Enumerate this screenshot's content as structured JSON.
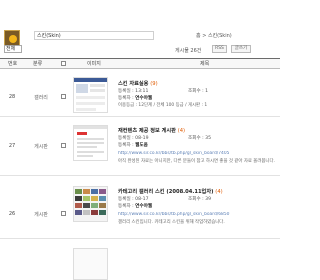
{
  "header": {
    "search_value": "스킨(Skin)",
    "breadcrumb": "홈 > 스킨(Skin)"
  },
  "toolbar": {
    "select_label": "전체",
    "count_text": "게시물 26건",
    "rss_label": "RSS",
    "write_label": "글쓰기"
  },
  "table": {
    "columns": [
      "번호",
      "분류",
      "",
      "이미지",
      "제목"
    ],
    "rows": [
      {
        "number": "28",
        "category": "갤러리",
        "title": "스킨 자료실용",
        "comments": "(9)",
        "reg_label": "등록일 :",
        "reg_value": "13:11",
        "views_label": "조회수 :",
        "views_value": "1",
        "author_label": "등록자 :",
        "author_value": "연수야웹",
        "summary1": "이용등급 : 12단계 / 전체 100 등급 / 게시판 : 1",
        "summary2": ""
      },
      {
        "number": "27",
        "category": "게시판",
        "title": "재컨텐츠 제공 정보 게시판",
        "comments": "(4)",
        "reg_label": "등록일 :",
        "reg_value": "08-19",
        "views_label": "조회수 :",
        "views_value": "35",
        "author_label": "등록자 :",
        "author_value": "웹도움",
        "summary1": "http://www.sir.co.kr/bbs/tb.php/gl_skin_board/7405",
        "summary2": "아직 완성된 자료는 아니지만, 다른 분들이 참고 하시면 좋을 것 같아 자료 올려봅니다."
      },
      {
        "number": "26",
        "category": "게시판",
        "title": "카테고리 갤러리 스킨 (2008.04.11업자)",
        "comments": "(4)",
        "reg_label": "등록일 :",
        "reg_value": "08-17",
        "views_label": "조회수 :",
        "views_value": "39",
        "author_label": "등록자 :",
        "author_value": "연수야웹",
        "summary1": "http://www.sir.co.kr/bbs/tb.php/gl_skin_board/6850",
        "summary2": "갤러리 스킨입니다. 카테고리 스킨을 위해 작업하였습니다."
      }
    ]
  },
  "colors": {
    "header_border": "#6b6b6b",
    "link": "#5b7fb5",
    "logo_bg": "#7a5a25",
    "logo_sun": "#f2b51a"
  }
}
